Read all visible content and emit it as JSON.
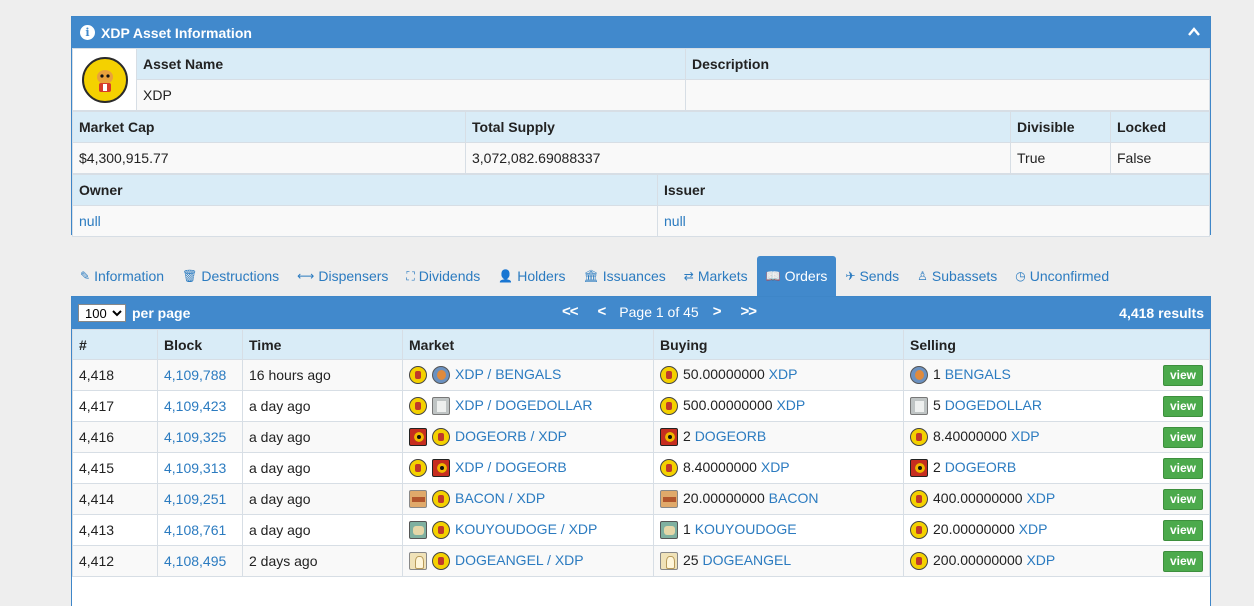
{
  "asset": {
    "panel_title": "XDP Asset Information",
    "labels": {
      "asset_name": "Asset Name",
      "description": "Description",
      "market_cap": "Market Cap",
      "total_supply": "Total Supply",
      "divisible": "Divisible",
      "locked": "Locked",
      "owner": "Owner",
      "issuer": "Issuer"
    },
    "values": {
      "asset_name": "XDP",
      "description": "",
      "market_cap": "$4,300,915.77",
      "total_supply": "3,072,082.69088337",
      "divisible": "True",
      "locked": "False",
      "owner": "null",
      "issuer": "null"
    }
  },
  "tabs": [
    {
      "label": "Information",
      "icon": "pencil-icon",
      "glyph": "✎"
    },
    {
      "label": "Destructions",
      "icon": "trash-icon",
      "glyph": "🗑"
    },
    {
      "label": "Dispensers",
      "icon": "arrows-horizontal-icon",
      "glyph": "⟷"
    },
    {
      "label": "Dividends",
      "icon": "sitemap-icon",
      "glyph": "⛶"
    },
    {
      "label": "Holders",
      "icon": "user-icon",
      "glyph": "👤"
    },
    {
      "label": "Issuances",
      "icon": "bank-icon",
      "glyph": "🏛"
    },
    {
      "label": "Markets",
      "icon": "exchange-icon",
      "glyph": "⇄"
    },
    {
      "label": "Orders",
      "icon": "book-icon",
      "glyph": "📖",
      "active": true
    },
    {
      "label": "Sends",
      "icon": "paper-plane-icon",
      "glyph": "✈"
    },
    {
      "label": "Subassets",
      "icon": "child-icon",
      "glyph": "♙"
    },
    {
      "label": "Unconfirmed",
      "icon": "clock-icon",
      "glyph": "◷"
    }
  ],
  "orders": {
    "per_page_value": "100",
    "per_page_label": "per page",
    "first_label": "<<",
    "prev_label": "<",
    "page_text": "Page 1 of 45",
    "next_label": ">",
    "last_label": ">>",
    "results_text": "4,418 results",
    "columns": [
      "#",
      "Block",
      "Time",
      "Market",
      "Buying",
      "Selling"
    ],
    "view_label": "view",
    "rows": [
      {
        "num": "4,418",
        "block": "4,109,788",
        "time": "16 hours ago",
        "market": "XDP / BENGALS",
        "m_icons": [
          "xdp",
          "bengals"
        ],
        "buy_amt": "50.00000000",
        "buy_asset": "XDP",
        "buy_icon": "xdp",
        "sell_amt": "1",
        "sell_asset": "BENGALS",
        "sell_icon": "bengals"
      },
      {
        "num": "4,417",
        "block": "4,109,423",
        "time": "a day ago",
        "market": "XDP / DOGEDOLLAR",
        "m_icons": [
          "xdp",
          "dogedollar"
        ],
        "buy_amt": "500.00000000",
        "buy_asset": "XDP",
        "buy_icon": "xdp",
        "sell_amt": "5",
        "sell_asset": "DOGEDOLLAR",
        "sell_icon": "dogedollar"
      },
      {
        "num": "4,416",
        "block": "4,109,325",
        "time": "a day ago",
        "market": "DOGEORB / XDP",
        "m_icons": [
          "dogeorb",
          "xdp"
        ],
        "buy_amt": "2",
        "buy_asset": "DOGEORB",
        "buy_icon": "dogeorb",
        "sell_amt": "8.40000000",
        "sell_asset": "XDP",
        "sell_icon": "xdp"
      },
      {
        "num": "4,415",
        "block": "4,109,313",
        "time": "a day ago",
        "market": "XDP / DOGEORB",
        "m_icons": [
          "xdp",
          "dogeorb"
        ],
        "buy_amt": "8.40000000",
        "buy_asset": "XDP",
        "buy_icon": "xdp",
        "sell_amt": "2",
        "sell_asset": "DOGEORB",
        "sell_icon": "dogeorb"
      },
      {
        "num": "4,414",
        "block": "4,109,251",
        "time": "a day ago",
        "market": "BACON / XDP",
        "m_icons": [
          "bacon",
          "xdp"
        ],
        "buy_amt": "20.00000000",
        "buy_asset": "BACON",
        "buy_icon": "bacon",
        "sell_amt": "400.00000000",
        "sell_asset": "XDP",
        "sell_icon": "xdp"
      },
      {
        "num": "4,413",
        "block": "4,108,761",
        "time": "a day ago",
        "market": "KOUYOUDOGE / XDP",
        "m_icons": [
          "kouyou",
          "xdp"
        ],
        "buy_amt": "1",
        "buy_asset": "KOUYOUDOGE",
        "buy_icon": "kouyou",
        "sell_amt": "20.00000000",
        "sell_asset": "XDP",
        "sell_icon": "xdp"
      },
      {
        "num": "4,412",
        "block": "4,108,495",
        "time": "2 days ago",
        "market": "DOGEANGEL / XDP",
        "m_icons": [
          "angel",
          "xdp"
        ],
        "buy_amt": "25",
        "buy_asset": "DOGEANGEL",
        "buy_icon": "angel",
        "sell_amt": "200.00000000",
        "sell_asset": "XDP",
        "sell_icon": "xdp"
      }
    ]
  },
  "colors": {
    "panel_header": "#4189cc",
    "label_row": "#d9ecf7",
    "link": "#2b7bc0",
    "view_button": "#4caa4c"
  }
}
